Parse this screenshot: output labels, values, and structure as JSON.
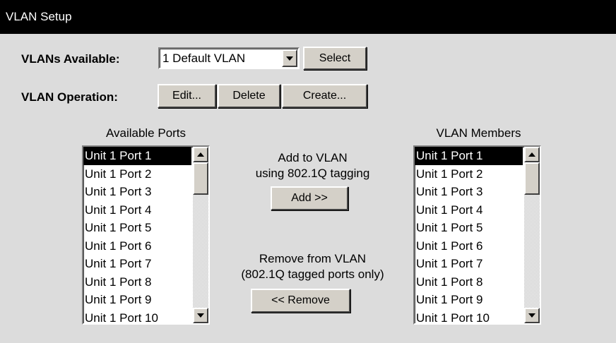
{
  "window": {
    "title": "VLAN Setup"
  },
  "vlans_available": {
    "label": "VLANs Available:",
    "selected": "1 Default VLAN",
    "select_button": "Select"
  },
  "vlan_operation": {
    "label": "VLAN Operation:",
    "edit": "Edit...",
    "delete": "Delete",
    "create": "Create..."
  },
  "available_ports": {
    "title": "Available Ports",
    "items": [
      "Unit 1 Port 1",
      "Unit 1 Port 2",
      "Unit 1 Port 3",
      "Unit 1 Port 4",
      "Unit 1 Port 5",
      "Unit 1 Port 6",
      "Unit 1 Port 7",
      "Unit 1 Port 8",
      "Unit 1 Port 9",
      "Unit 1 Port 10"
    ],
    "selected_index": 0
  },
  "vlan_members": {
    "title": "VLAN Members",
    "items": [
      "Unit 1 Port 1",
      "Unit 1 Port 2",
      "Unit 1 Port 3",
      "Unit 1 Port 4",
      "Unit 1 Port 5",
      "Unit 1 Port 6",
      "Unit 1 Port 7",
      "Unit 1 Port 8",
      "Unit 1 Port 9",
      "Unit 1 Port 10"
    ],
    "selected_index": 0
  },
  "add": {
    "line1": "Add to VLAN",
    "line2": "using 802.1Q tagging",
    "button": "Add >>"
  },
  "remove": {
    "line1": "Remove from VLAN",
    "line2": "(802.1Q tagged ports only)",
    "button": "<< Remove"
  },
  "icons": {
    "dropdown": "chevron-down-icon",
    "scroll_up": "scroll-up-arrow-icon",
    "scroll_down": "scroll-down-arrow-icon"
  }
}
